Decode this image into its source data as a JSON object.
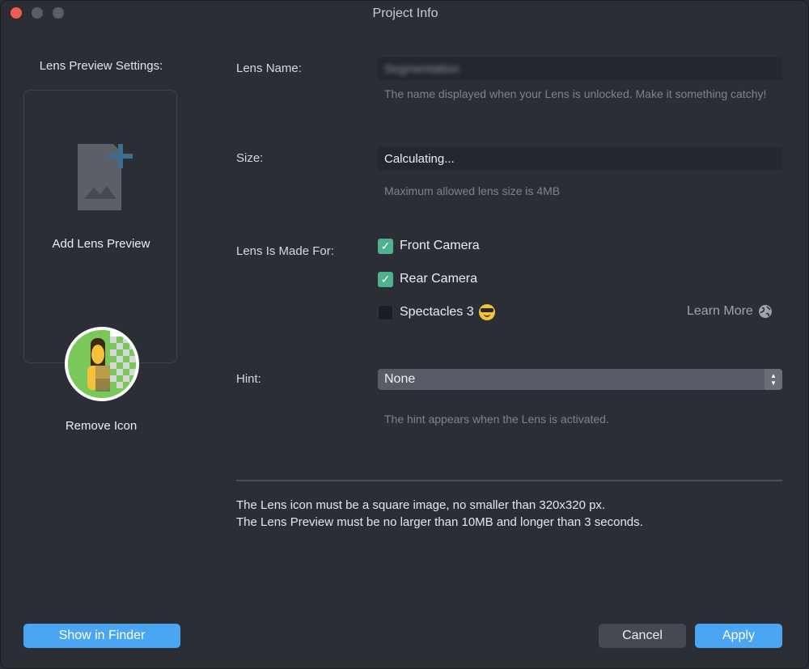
{
  "window": {
    "title": "Project Info"
  },
  "sidebar": {
    "title": "Lens Preview Settings:",
    "add_preview_label": "Add Lens Preview",
    "remove_icon_label": "Remove Icon",
    "show_in_finder_label": "Show in Finder"
  },
  "form": {
    "lens_name": {
      "label": "Lens Name:",
      "value": "Segmentation",
      "help": "The name displayed when your Lens is unlocked. Make it something catchy!"
    },
    "size": {
      "label": "Size:",
      "value": "Calculating...",
      "help": "Maximum allowed lens size is 4MB"
    },
    "made_for": {
      "label": "Lens Is Made For:",
      "options": [
        {
          "label": "Front Camera",
          "checked": true
        },
        {
          "label": "Rear Camera",
          "checked": true
        },
        {
          "label": "Spectacles 3",
          "checked": false
        }
      ],
      "learn_more": "Learn More"
    },
    "hint": {
      "label": "Hint:",
      "value": "None",
      "help": "The hint appears when the Lens is activated."
    }
  },
  "notes": {
    "line1": "The Lens icon must be a square image, no smaller than 320x320 px.",
    "line2": "The Lens Preview must be no larger than 10MB and longer than 3 seconds."
  },
  "footer": {
    "cancel_label": "Cancel",
    "apply_label": "Apply"
  },
  "colors": {
    "accent": "#4aa6f2",
    "checkbox_checked": "#4fb18d",
    "background": "#2b2e35"
  },
  "icons": [
    "add-image-icon",
    "checkmark-icon",
    "sunglasses-emoji-icon",
    "globe-icon",
    "chevron-updown-icon"
  ]
}
